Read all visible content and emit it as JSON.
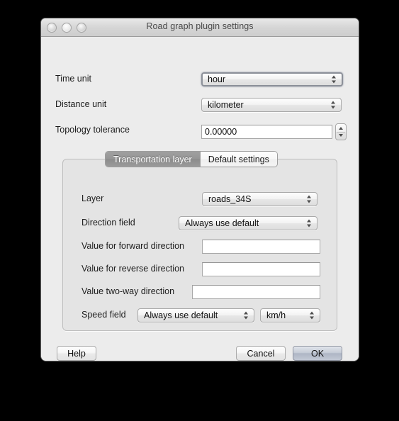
{
  "window": {
    "title": "Road graph plugin settings",
    "traffic_lights": [
      "close-button",
      "minimize-button",
      "zoom-button"
    ]
  },
  "general": {
    "time_unit": {
      "label": "Time unit",
      "value": "hour"
    },
    "distance_unit": {
      "label": "Distance unit",
      "value": "kilometer"
    },
    "topology_tolerance": {
      "label": "Topology tolerance",
      "value": "0.00000"
    }
  },
  "tabs": [
    {
      "label": "Transportation layer",
      "selected": true
    },
    {
      "label": "Default settings",
      "selected": false
    }
  ],
  "transportation_layer": {
    "layer": {
      "label": "Layer",
      "value": "roads_34S"
    },
    "direction_field": {
      "label": "Direction field",
      "value": "Always use default"
    },
    "forward_direction": {
      "label": "Value for forward direction",
      "value": "",
      "placeholder": ""
    },
    "reverse_direction": {
      "label": "Value for reverse direction",
      "value": "",
      "placeholder": ""
    },
    "two_way_direction": {
      "label": "Value two-way direction",
      "value": "",
      "placeholder": ""
    },
    "speed_field": {
      "label": "Speed field",
      "value": "Always use default"
    },
    "speed_unit": {
      "value": "km/h"
    }
  },
  "buttons": {
    "help": "Help",
    "cancel": "Cancel",
    "ok": "OK"
  },
  "colors": {
    "window_bg": "#ececec",
    "groupbox_bg": "#e4e4e4",
    "tab_selected_bg": "#959595",
    "default_button_accent": "#c7cdd8",
    "desktop_bg": "#000000"
  }
}
